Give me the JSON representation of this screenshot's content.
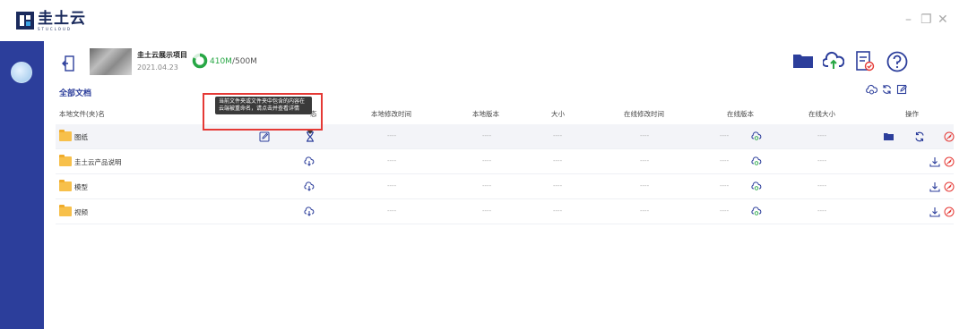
{
  "app": {
    "logo_title": "圭土云",
    "logo_sub": "STUCLOUD"
  },
  "window_controls": {
    "minimize": "–",
    "restore": "❐",
    "close": "✕"
  },
  "project": {
    "name": "圭土云展示项目",
    "date": "2021.04.23",
    "storage_used": "410M",
    "storage_sep_total": "/500M",
    "storage_fraction": 0.82
  },
  "section_title": "全部文档",
  "columns": {
    "local_name": "本地文件(夹)名",
    "status_fragment": "态",
    "local_modified": "本地修改时间",
    "local_version": "本地版本",
    "size": "大小",
    "online_modified": "在线修改时间",
    "online_version": "在线版本",
    "online_size": "在线大小",
    "actions": "操作"
  },
  "tooltip": {
    "text": "当前文件夹或文件夹中包含的内容在云端被重命名，请点击并查看详情"
  },
  "rows": [
    {
      "name": "图纸",
      "local_modified": "----",
      "local_version": "----",
      "size": "----",
      "online_modified": "----",
      "online_version": "----",
      "online_size": "----"
    },
    {
      "name": "圭土云产品说明",
      "local_modified": "----",
      "local_version": "----",
      "size": "----",
      "online_modified": "----",
      "online_version": "----",
      "online_size": "----"
    },
    {
      "name": "模型",
      "local_modified": "----",
      "local_version": "----",
      "size": "----",
      "online_modified": "----",
      "online_version": "----",
      "online_size": "----"
    },
    {
      "name": "视频",
      "local_modified": "----",
      "local_version": "----",
      "size": "----",
      "online_modified": "----",
      "online_version": "----",
      "online_size": "----"
    }
  ],
  "colors": {
    "sidebar": "#2c3e9b",
    "accent": "#2c3e9b",
    "storage_green": "#28a745",
    "danger": "#e53935"
  }
}
